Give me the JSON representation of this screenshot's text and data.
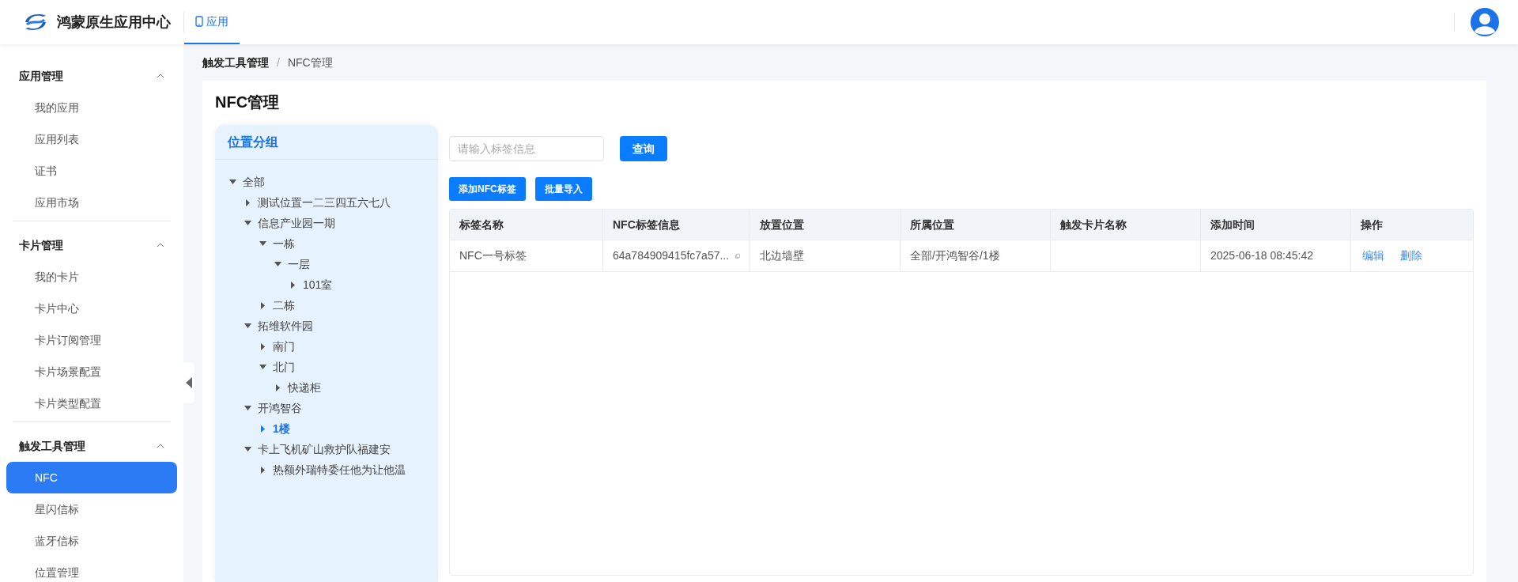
{
  "header": {
    "app_title": "鸿蒙原生应用中心",
    "tabs": [
      {
        "label": "应用",
        "selected": true
      }
    ]
  },
  "sidebar": {
    "groups": [
      {
        "title": "应用管理",
        "expanded": true,
        "items": [
          {
            "label": "我的应用",
            "selected": false
          },
          {
            "label": "应用列表",
            "selected": false
          },
          {
            "label": "证书",
            "selected": false
          },
          {
            "label": "应用市场",
            "selected": false
          }
        ]
      },
      {
        "title": "卡片管理",
        "expanded": true,
        "items": [
          {
            "label": "我的卡片",
            "selected": false
          },
          {
            "label": "卡片中心",
            "selected": false
          },
          {
            "label": "卡片订阅管理",
            "selected": false
          },
          {
            "label": "卡片场景配置",
            "selected": false
          },
          {
            "label": "卡片类型配置",
            "selected": false
          }
        ]
      },
      {
        "title": "触发工具管理",
        "expanded": true,
        "items": [
          {
            "label": "NFC",
            "selected": true
          },
          {
            "label": "星闪信标",
            "selected": false
          },
          {
            "label": "蓝牙信标",
            "selected": false
          },
          {
            "label": "位置管理",
            "selected": false
          }
        ]
      }
    ]
  },
  "breadcrumb": [
    "触发工具管理",
    "NFC管理"
  ],
  "breadcrumb_separator": "/",
  "page_title": "NFC管理",
  "location_tree": {
    "title": "位置分组",
    "nodes": [
      {
        "label": "全部",
        "expanded": true,
        "selected": false,
        "children": [
          {
            "label": "测试位置一二三四五六七八",
            "expanded": false,
            "selected": false
          },
          {
            "label": "信息产业园一期",
            "expanded": true,
            "selected": false,
            "children": [
              {
                "label": "一栋",
                "expanded": true,
                "selected": false,
                "children": [
                  {
                    "label": "一层",
                    "expanded": true,
                    "selected": false,
                    "children": [
                      {
                        "label": "101室",
                        "expanded": false,
                        "selected": false
                      }
                    ]
                  }
                ]
              },
              {
                "label": "二栋",
                "expanded": false,
                "selected": false
              }
            ]
          },
          {
            "label": "拓维软件园",
            "expanded": true,
            "selected": false,
            "children": [
              {
                "label": "南门",
                "expanded": false,
                "selected": false
              },
              {
                "label": "北门",
                "expanded": true,
                "selected": false,
                "children": [
                  {
                    "label": "快递柜",
                    "expanded": false,
                    "selected": false
                  }
                ]
              }
            ]
          },
          {
            "label": "开鸿智谷",
            "expanded": true,
            "selected": false,
            "children": [
              {
                "label": "1楼",
                "expanded": false,
                "selected": true
              }
            ]
          },
          {
            "label": "卡上飞机矿山救护队福建安",
            "expanded": true,
            "selected": false,
            "children": [
              {
                "label": "热额外瑞特委任他为让他温",
                "expanded": false,
                "selected": false
              }
            ]
          }
        ]
      }
    ]
  },
  "search": {
    "placeholder": "请输入标签信息",
    "button": "查询"
  },
  "actions": [
    "添加NFC标签",
    "批量导入"
  ],
  "table": {
    "columns": [
      "标签名称",
      "NFC标签信息",
      "放置位置",
      "所属位置",
      "触发卡片名称",
      "添加时间",
      "操作"
    ],
    "rows": [
      {
        "name": "NFC一号标签",
        "nfc_info": "64a784909415fc7a57...",
        "placement": "北边墙壁",
        "location": "全部/开鸿智谷/1楼",
        "added": "2025-06-18 08:45:42",
        "operations": [
          "编辑",
          "删除"
        ]
      }
    ]
  }
}
